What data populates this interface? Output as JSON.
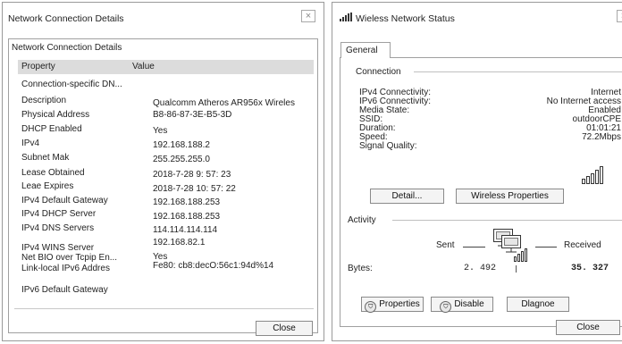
{
  "details_window": {
    "title": "Network Connection Details",
    "close_x": "×",
    "group_title": "Network Connection Details",
    "columns": [
      "Property",
      "Value"
    ],
    "rows": [
      {
        "property": "Connection-specific DN...",
        "value": ""
      },
      {
        "property": "Description",
        "value": "Qualcomm Atheros AR956x Wireles"
      },
      {
        "property": "Physical Address",
        "value": "B8-86-87-3E-B5-3D"
      },
      {
        "property": "DHCP Enabled",
        "value": "Yes"
      },
      {
        "property": "IPv4",
        "value": "192.168.188.2"
      },
      {
        "property": "Subnet Mak",
        "value": "255.255.255.0"
      },
      {
        "property": "Lease Obtained",
        "value": "2018-7-28  9: 57: 23"
      },
      {
        "property": "Leae Expires",
        "value": "2018-7-28  10: 57: 22"
      },
      {
        "property": "IPv4 Default Gateway",
        "value": "192.168.188.253"
      },
      {
        "property": "IPv4 DHCP Server",
        "value": "192.168.188.253"
      },
      {
        "property": "IPv4 DNS Servers",
        "value": "114.114.114.114"
      },
      {
        "property": "",
        "value": "192.168.82.1"
      },
      {
        "property": "IPv4 WINS Server",
        "value": ""
      },
      {
        "property": "Net BIO over Tcpip En...",
        "value": "Yes"
      },
      {
        "property": "Link-local IPv6 Addres",
        "value": "Fe80: cb8:decO:56c1:94d%14"
      },
      {
        "property": "IPv6 Default Gateway",
        "value": ""
      }
    ],
    "close_button": "Close"
  },
  "status_window": {
    "title": "Wieless Network Status",
    "close_x": "×",
    "tab_general": "General",
    "connection_title": "Connection",
    "connection_rows": [
      {
        "label": "IPv4 Connectivity:",
        "value": "Internet"
      },
      {
        "label": "IPv6 Connectivity:",
        "value": "No Internet access"
      },
      {
        "label": "Media State:",
        "value": "Enabled"
      },
      {
        "label": "SSID:",
        "value": "outdoorCPE"
      },
      {
        "label": "Duration:",
        "value": "01:01:21"
      },
      {
        "label": "Speed:",
        "value": "72.2Mbps"
      },
      {
        "label": "Signal Quality:",
        "value": ""
      }
    ],
    "detail_button": "Detail...",
    "wireless_properties_button": "Wireless Properties",
    "activity_title": "Activity",
    "sent_label": "Sent",
    "received_label": "Received",
    "bytes_label": "Bytes:",
    "bytes_sent": "2. 492",
    "bytes_received": "35. 327",
    "properties_button": "Properties",
    "disable_button": "Disable",
    "diagnose_button": "Dlagnoe",
    "close_button": "Close"
  }
}
